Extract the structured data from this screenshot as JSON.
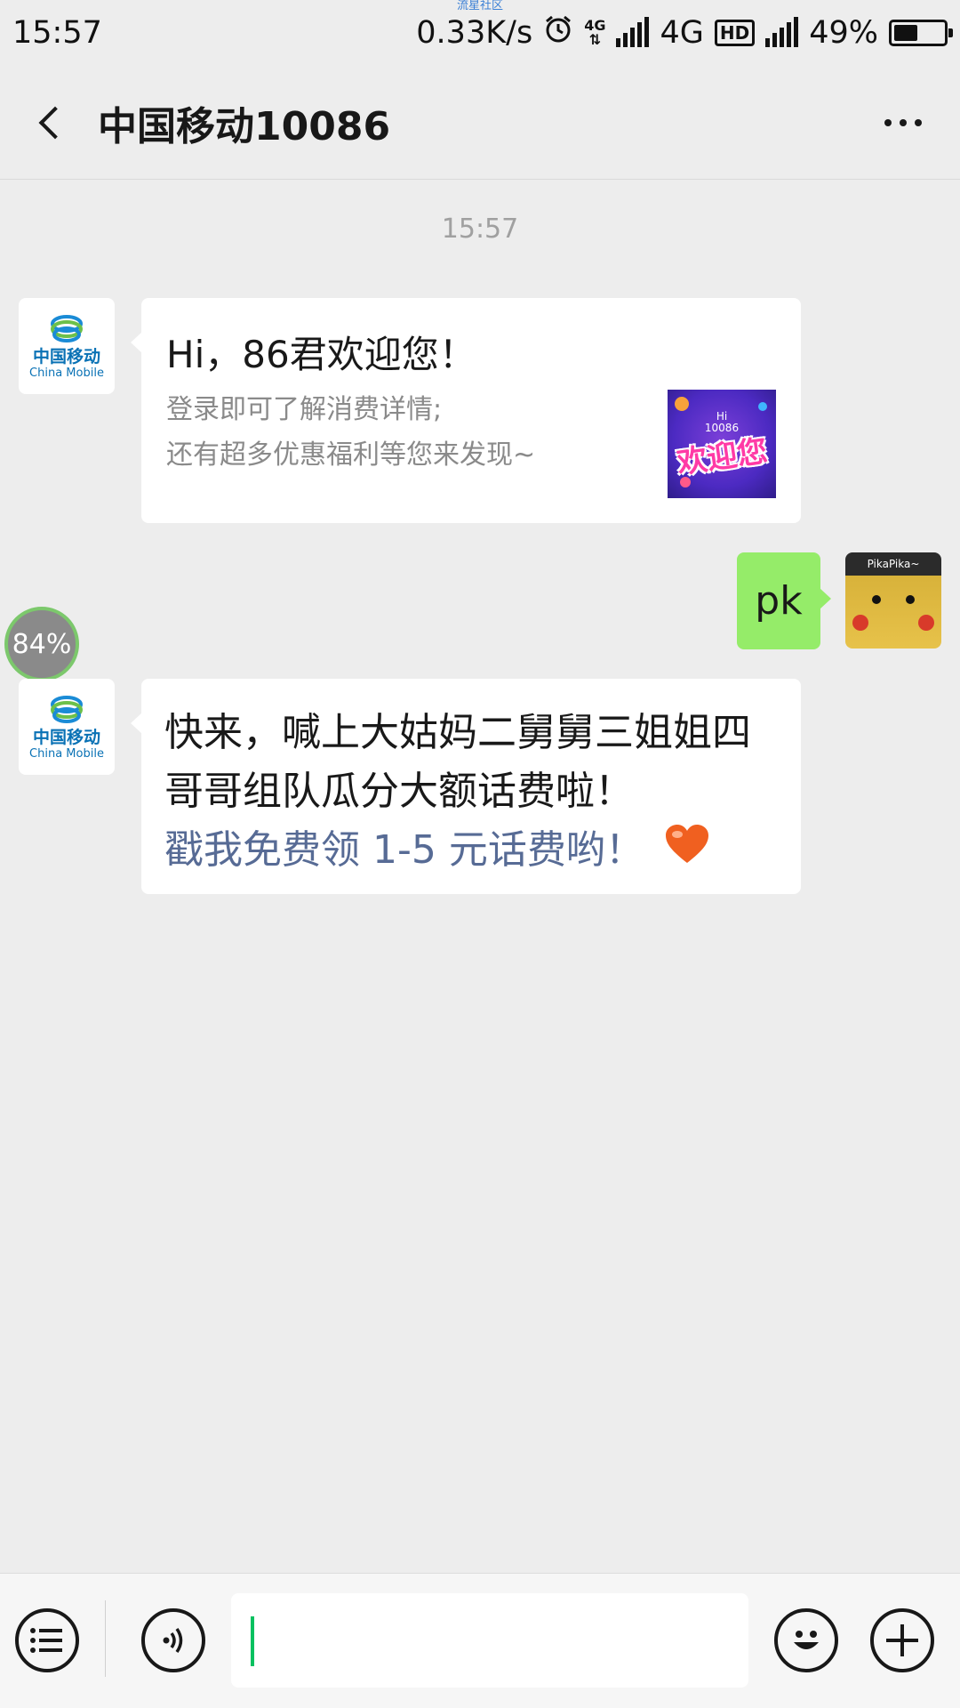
{
  "status_bar": {
    "time": "15:57",
    "network_speed": "0.33K/s",
    "watermark": "流星社区",
    "net_type_small": "4G",
    "net_type": "4G",
    "hd_label": "HD",
    "battery_percent": "49%",
    "battery_level": 0.49
  },
  "nav": {
    "title": "中国移动10086"
  },
  "chat": {
    "timestamp": "15:57",
    "sender_logo_zh": "中国移动",
    "sender_logo_en": "China Mobile",
    "card": {
      "title": "Hi，86君欢迎您！",
      "desc_line1": "登录即可了解消费详情;",
      "desc_line2": "还有超多优惠福利等您来发现~",
      "thumb_hi": "Hi",
      "thumb_number": "10086",
      "thumb_text": "欢迎您"
    },
    "my_message": "pk",
    "my_avatar_caption": "PikaPika~",
    "float_ball_label": "84%",
    "message2": {
      "text_line1": "快来，喊上大姑妈二舅舅三姐姐四",
      "text_line2": "哥哥组队瓜分大额话费啦！",
      "link_text": "戳我免费领 1-5 元话费哟！"
    }
  },
  "colors": {
    "background": "#ededed",
    "outgoing_bubble": "#95ec69",
    "link": "#576b95",
    "caret": "#07c160"
  }
}
